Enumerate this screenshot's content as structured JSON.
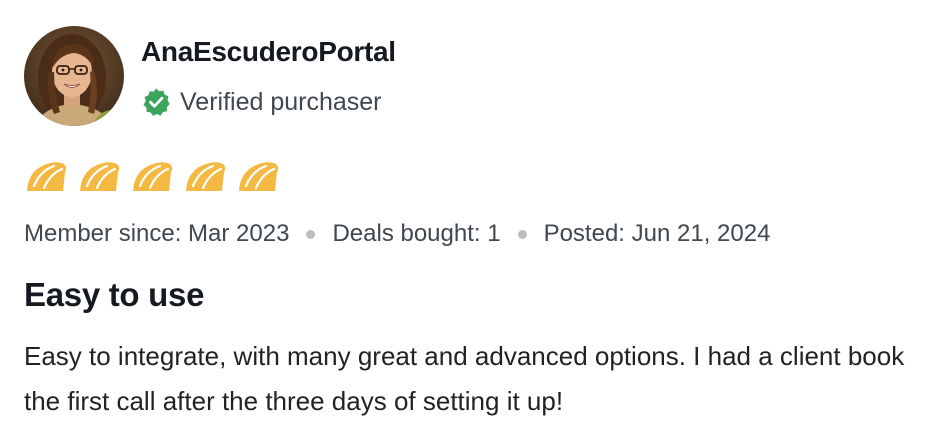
{
  "reviewer": {
    "name": "AnaEscuderoPortal",
    "badge_icon": "verified-check-icon",
    "badge_label": "Verified purchaser",
    "avatar": "reviewer-avatar-photo"
  },
  "rating": {
    "value": 5,
    "max": 5,
    "icon": "taco-icon",
    "color": "#f4b942"
  },
  "meta": {
    "member_since": "Member since: Mar 2023",
    "deals_bought": "Deals bought: 1",
    "posted": "Posted: Jun 21, 2024"
  },
  "review": {
    "title": "Easy to use",
    "body": "Easy to integrate, with many great and advanced options. I had a client book the first call after the three days of setting it up!"
  },
  "colors": {
    "verified_green": "#3ca55c",
    "text_dark": "#141a1f",
    "text_muted": "#3f474f",
    "separator": "#b9bec3"
  }
}
